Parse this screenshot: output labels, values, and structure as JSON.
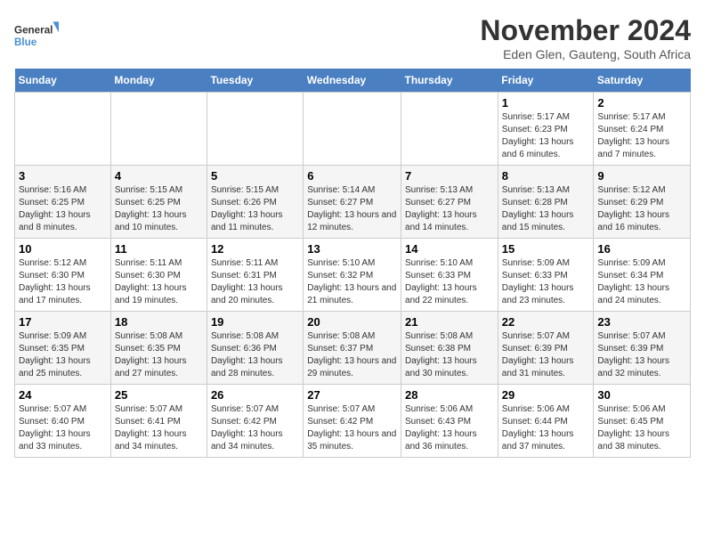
{
  "logo": {
    "line1": "General",
    "line2": "Blue"
  },
  "title": "November 2024",
  "subtitle": "Eden Glen, Gauteng, South Africa",
  "days_of_week": [
    "Sunday",
    "Monday",
    "Tuesday",
    "Wednesday",
    "Thursday",
    "Friday",
    "Saturday"
  ],
  "weeks": [
    [
      {
        "day": "",
        "info": ""
      },
      {
        "day": "",
        "info": ""
      },
      {
        "day": "",
        "info": ""
      },
      {
        "day": "",
        "info": ""
      },
      {
        "day": "",
        "info": ""
      },
      {
        "day": "1",
        "info": "Sunrise: 5:17 AM\nSunset: 6:23 PM\nDaylight: 13 hours and 6 minutes."
      },
      {
        "day": "2",
        "info": "Sunrise: 5:17 AM\nSunset: 6:24 PM\nDaylight: 13 hours and 7 minutes."
      }
    ],
    [
      {
        "day": "3",
        "info": "Sunrise: 5:16 AM\nSunset: 6:25 PM\nDaylight: 13 hours and 8 minutes."
      },
      {
        "day": "4",
        "info": "Sunrise: 5:15 AM\nSunset: 6:25 PM\nDaylight: 13 hours and 10 minutes."
      },
      {
        "day": "5",
        "info": "Sunrise: 5:15 AM\nSunset: 6:26 PM\nDaylight: 13 hours and 11 minutes."
      },
      {
        "day": "6",
        "info": "Sunrise: 5:14 AM\nSunset: 6:27 PM\nDaylight: 13 hours and 12 minutes."
      },
      {
        "day": "7",
        "info": "Sunrise: 5:13 AM\nSunset: 6:27 PM\nDaylight: 13 hours and 14 minutes."
      },
      {
        "day": "8",
        "info": "Sunrise: 5:13 AM\nSunset: 6:28 PM\nDaylight: 13 hours and 15 minutes."
      },
      {
        "day": "9",
        "info": "Sunrise: 5:12 AM\nSunset: 6:29 PM\nDaylight: 13 hours and 16 minutes."
      }
    ],
    [
      {
        "day": "10",
        "info": "Sunrise: 5:12 AM\nSunset: 6:30 PM\nDaylight: 13 hours and 17 minutes."
      },
      {
        "day": "11",
        "info": "Sunrise: 5:11 AM\nSunset: 6:30 PM\nDaylight: 13 hours and 19 minutes."
      },
      {
        "day": "12",
        "info": "Sunrise: 5:11 AM\nSunset: 6:31 PM\nDaylight: 13 hours and 20 minutes."
      },
      {
        "day": "13",
        "info": "Sunrise: 5:10 AM\nSunset: 6:32 PM\nDaylight: 13 hours and 21 minutes."
      },
      {
        "day": "14",
        "info": "Sunrise: 5:10 AM\nSunset: 6:33 PM\nDaylight: 13 hours and 22 minutes."
      },
      {
        "day": "15",
        "info": "Sunrise: 5:09 AM\nSunset: 6:33 PM\nDaylight: 13 hours and 23 minutes."
      },
      {
        "day": "16",
        "info": "Sunrise: 5:09 AM\nSunset: 6:34 PM\nDaylight: 13 hours and 24 minutes."
      }
    ],
    [
      {
        "day": "17",
        "info": "Sunrise: 5:09 AM\nSunset: 6:35 PM\nDaylight: 13 hours and 25 minutes."
      },
      {
        "day": "18",
        "info": "Sunrise: 5:08 AM\nSunset: 6:35 PM\nDaylight: 13 hours and 27 minutes."
      },
      {
        "day": "19",
        "info": "Sunrise: 5:08 AM\nSunset: 6:36 PM\nDaylight: 13 hours and 28 minutes."
      },
      {
        "day": "20",
        "info": "Sunrise: 5:08 AM\nSunset: 6:37 PM\nDaylight: 13 hours and 29 minutes."
      },
      {
        "day": "21",
        "info": "Sunrise: 5:08 AM\nSunset: 6:38 PM\nDaylight: 13 hours and 30 minutes."
      },
      {
        "day": "22",
        "info": "Sunrise: 5:07 AM\nSunset: 6:39 PM\nDaylight: 13 hours and 31 minutes."
      },
      {
        "day": "23",
        "info": "Sunrise: 5:07 AM\nSunset: 6:39 PM\nDaylight: 13 hours and 32 minutes."
      }
    ],
    [
      {
        "day": "24",
        "info": "Sunrise: 5:07 AM\nSunset: 6:40 PM\nDaylight: 13 hours and 33 minutes."
      },
      {
        "day": "25",
        "info": "Sunrise: 5:07 AM\nSunset: 6:41 PM\nDaylight: 13 hours and 34 minutes."
      },
      {
        "day": "26",
        "info": "Sunrise: 5:07 AM\nSunset: 6:42 PM\nDaylight: 13 hours and 34 minutes."
      },
      {
        "day": "27",
        "info": "Sunrise: 5:07 AM\nSunset: 6:42 PM\nDaylight: 13 hours and 35 minutes."
      },
      {
        "day": "28",
        "info": "Sunrise: 5:06 AM\nSunset: 6:43 PM\nDaylight: 13 hours and 36 minutes."
      },
      {
        "day": "29",
        "info": "Sunrise: 5:06 AM\nSunset: 6:44 PM\nDaylight: 13 hours and 37 minutes."
      },
      {
        "day": "30",
        "info": "Sunrise: 5:06 AM\nSunset: 6:45 PM\nDaylight: 13 hours and 38 minutes."
      }
    ]
  ]
}
